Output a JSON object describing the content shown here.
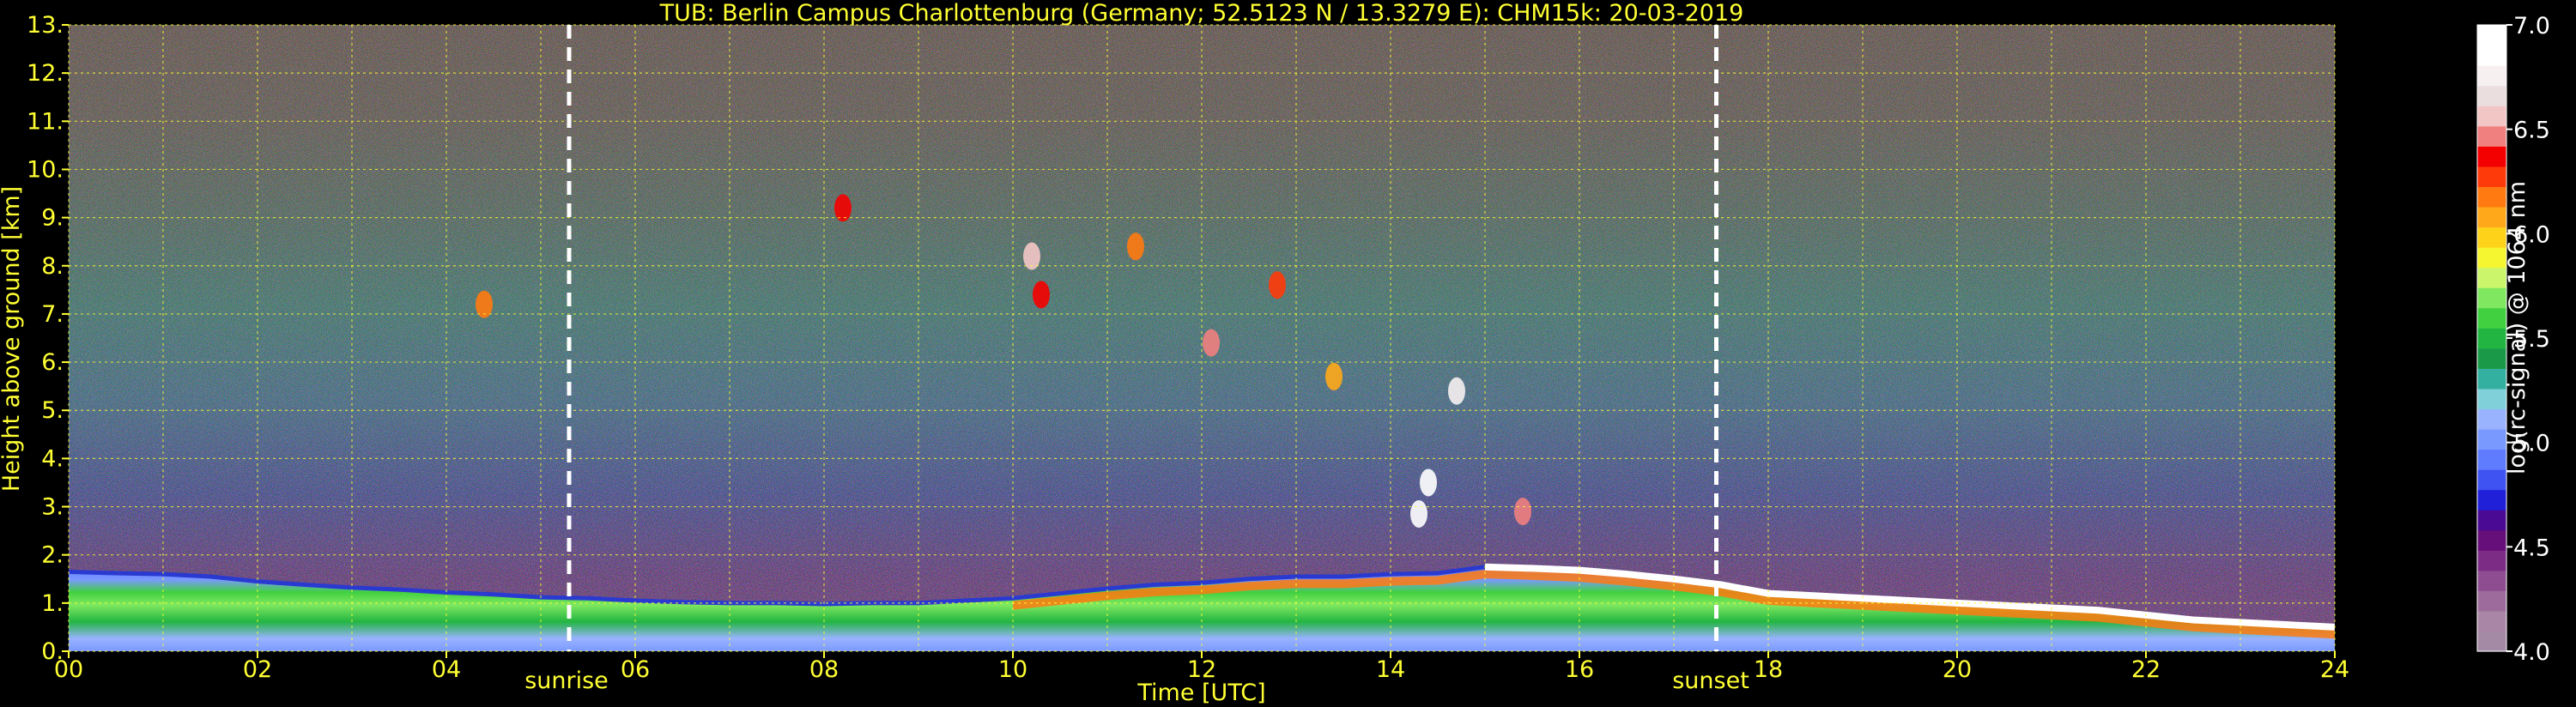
{
  "chart_data": {
    "type": "heatmap",
    "title": "TUB: Berlin Campus Charlottenburg (Germany; 52.5123 N / 13.3279 E):    CHM15k: 20-03-2019",
    "xlabel": "Time [UTC]",
    "ylabel": "Height above ground [km]",
    "xlim": [
      0,
      24
    ],
    "ylim": [
      0,
      13
    ],
    "x_ticks": [
      "00",
      "02",
      "04",
      "06",
      "08",
      "10",
      "12",
      "14",
      "16",
      "18",
      "20",
      "22",
      "24"
    ],
    "y_ticks": [
      "0.",
      "1.",
      "2.",
      "3.",
      "4.",
      "5.",
      "6.",
      "7.",
      "8.",
      "9.",
      "10.",
      "11.",
      "12.",
      "13."
    ],
    "grid": true,
    "events": [
      {
        "label": "sunrise",
        "time": 5.3
      },
      {
        "label": "sunset",
        "time": 17.45
      }
    ],
    "colorbar": {
      "label": "log(rc-signal) @ 1064 nm",
      "range": [
        4.0,
        7.0
      ],
      "ticks": [
        "4.0",
        "4.5",
        "5.0",
        "5.5",
        "6.0",
        "6.5",
        "7.0"
      ],
      "colors_bottom_to_top": [
        "#a48aa5",
        "#a986a6",
        "#9d6c9c",
        "#8e4d90",
        "#7d2c86",
        "#660f7a",
        "#4b0a93",
        "#2020d8",
        "#3f52f2",
        "#5f7cff",
        "#7a99ff",
        "#99b3ff",
        "#7fd0d8",
        "#33b0a0",
        "#1a9a48",
        "#23b542",
        "#40d040",
        "#7fe860",
        "#cbf56a",
        "#f5f530",
        "#ffd21a",
        "#ffa81a",
        "#ff7a10",
        "#ff3a0a",
        "#f50000",
        "#f08080",
        "#f3c6c6",
        "#eadede",
        "#f6f0f0",
        "#ffffff",
        "#ffffff"
      ]
    },
    "series": [
      {
        "name": "",
        "x": [
          0,
          0.5,
          1,
          1.5,
          2,
          2.5,
          3,
          3.5,
          4,
          4.5,
          5,
          5.5,
          6,
          6.5,
          7,
          7.5,
          8,
          8.5,
          9,
          9.5,
          10,
          10.5,
          11,
          11.5,
          12,
          12.5,
          13,
          13.5,
          14,
          14.5,
          15,
          15.5,
          16,
          16.5,
          17,
          17.5,
          18,
          18.5,
          19,
          19.5,
          20,
          20.5,
          21,
          21.5,
          22,
          22.5,
          23,
          23.5,
          24
        ],
        "y": [
          1.65,
          1.62,
          1.6,
          1.55,
          1.45,
          1.38,
          1.32,
          1.28,
          1.22,
          1.18,
          1.12,
          1.1,
          1.05,
          1.02,
          1.0,
          1.0,
          0.98,
          1.0,
          1.0,
          1.05,
          1.1,
          1.2,
          1.3,
          1.38,
          1.42,
          1.5,
          1.55,
          1.55,
          1.6,
          1.62,
          1.75,
          1.72,
          1.68,
          1.6,
          1.5,
          1.38,
          1.2,
          1.15,
          1.1,
          1.05,
          1.0,
          0.95,
          0.9,
          0.85,
          0.75,
          0.65,
          0.6,
          0.55,
          0.5
        ]
      }
    ],
    "cloud_patches": [
      {
        "t": 4.4,
        "h": 7.2,
        "level": 6.2
      },
      {
        "t": 8.2,
        "h": 9.2,
        "level": 6.4
      },
      {
        "t": 10.2,
        "h": 8.2,
        "level": 6.6
      },
      {
        "t": 10.3,
        "h": 7.4,
        "level": 6.4
      },
      {
        "t": 11.3,
        "h": 8.4,
        "level": 6.2
      },
      {
        "t": 12.1,
        "h": 6.4,
        "level": 6.5
      },
      {
        "t": 12.8,
        "h": 7.6,
        "level": 6.3
      },
      {
        "t": 13.4,
        "h": 5.7,
        "level": 6.1
      },
      {
        "t": 14.7,
        "h": 5.4,
        "level": 6.8
      },
      {
        "t": 14.4,
        "h": 3.5,
        "level": 6.9
      },
      {
        "t": 14.3,
        "h": 2.85,
        "level": 6.9
      },
      {
        "t": 15.4,
        "h": 2.9,
        "level": 6.5
      }
    ]
  },
  "labels": {
    "sunrise": "sunrise",
    "sunset": "sunset"
  }
}
